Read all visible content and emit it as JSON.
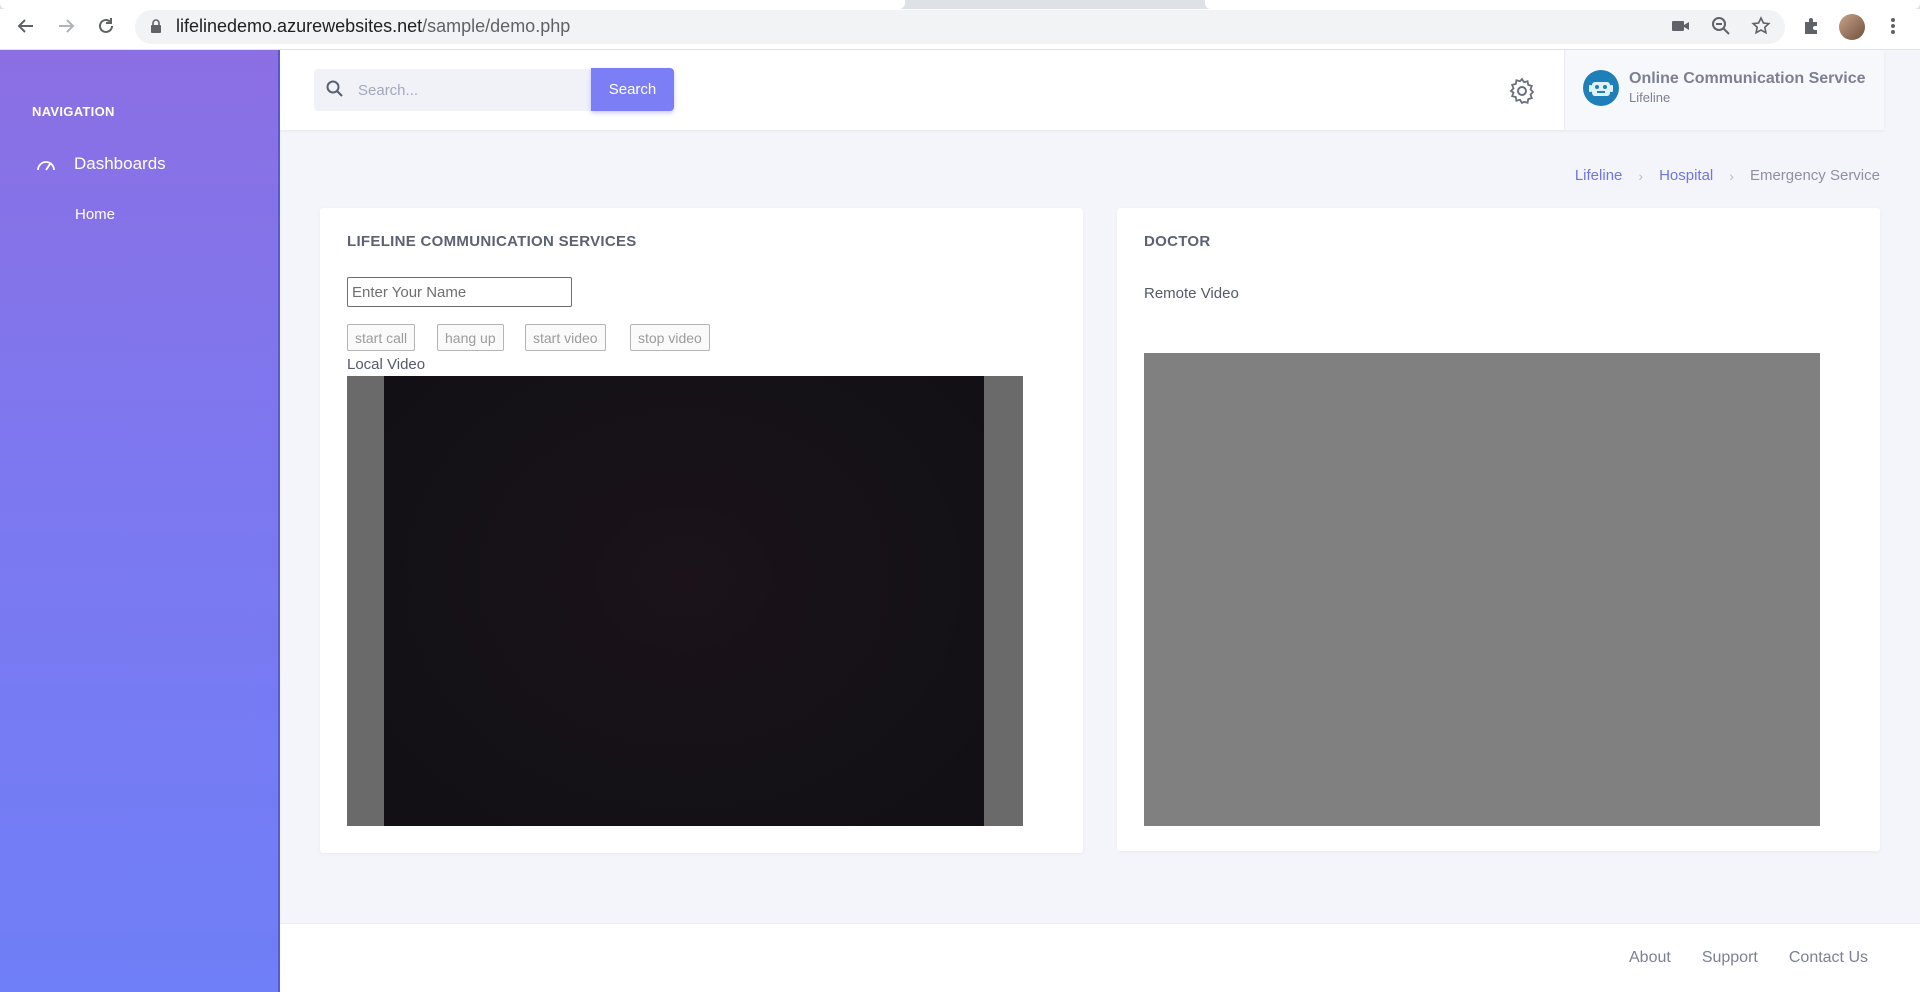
{
  "browser": {
    "url_host": "lifelinedemo.azurewebsites.net",
    "url_path": "/sample/demo.php"
  },
  "sidebar": {
    "heading": "NAVIGATION",
    "items": [
      {
        "label": "Dashboards",
        "icon": "gauge-icon"
      }
    ],
    "sub_items": [
      {
        "label": "Home"
      }
    ]
  },
  "header": {
    "search_placeholder": "Search...",
    "search_button": "Search",
    "profile_title": "Online Communication Service",
    "profile_subtitle": "Lifeline"
  },
  "breadcrumb": {
    "items": [
      "Lifeline",
      "Hospital"
    ],
    "current": "Emergency Service"
  },
  "local_card": {
    "title": "LIFELINE COMMUNICATION SERVICES",
    "name_placeholder": "Enter Your Name",
    "buttons": [
      "start call",
      "hang up",
      "start video",
      "stop video"
    ],
    "video_label": "Local Video"
  },
  "remote_card": {
    "title": "DOCTOR",
    "video_label": "Remote Video"
  },
  "footer": {
    "links": [
      "About",
      "Support",
      "Contact Us"
    ]
  },
  "colors": {
    "sidebar_top": "#8b6fe3",
    "sidebar_bottom": "#6f7ff7",
    "accent": "#7c7ef5",
    "breadcrumb_link": "#6f74e8"
  }
}
